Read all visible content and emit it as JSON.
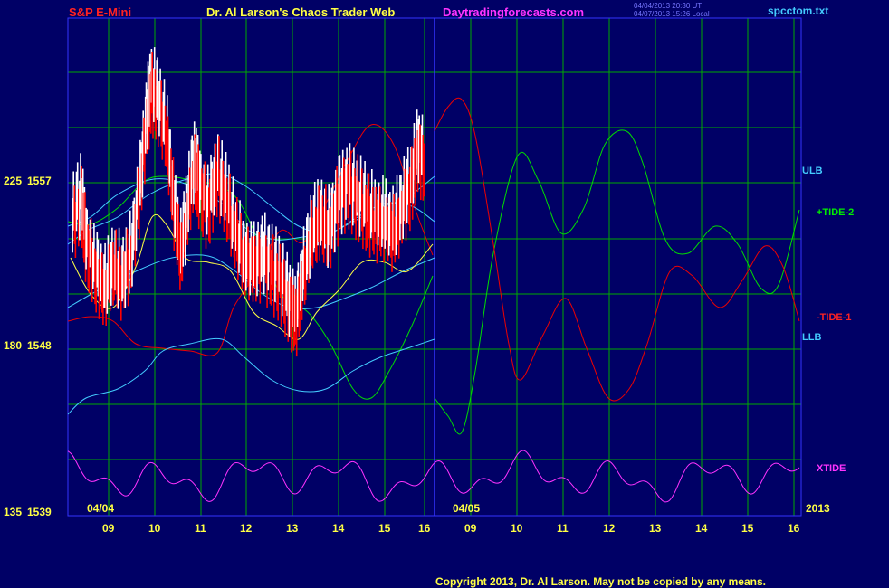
{
  "header": {
    "instrument": "S&P E-Mini",
    "site_title": "Dr. Al Larson's Chaos Trader Web",
    "site_url": "Daytradingforecasts.com",
    "timestamp_line1": "04/04/2013 20:30 UT",
    "timestamp_line2": "04/07/2013 15:26 Local",
    "file_name": "spcctom.txt"
  },
  "footer": {
    "copyright": "Copyright 2013, Dr. Al Larson. May not be copied by any means."
  },
  "colors": {
    "background": "#000066",
    "grid": "#00aa00",
    "frame": "#3333ff",
    "price_up": "#ffffff",
    "price_down": "#ff0000",
    "tide_plus": "#00dd00",
    "tide_minus": "#ee0000",
    "ulb": "#44ccff",
    "llb": "#44ccff",
    "xtide": "#ff33ff",
    "avg": "#ffff44"
  },
  "chart_data": {
    "type": "line",
    "y_labels": [
      {
        "tide": "225",
        "price": "1557"
      },
      {
        "tide": "180",
        "price": "1548"
      },
      {
        "tide": "135",
        "price": "1539"
      }
    ],
    "price_range": [
      1539,
      1560
    ],
    "x_hour_labels": [
      "09",
      "10",
      "11",
      "12",
      "13",
      "14",
      "15",
      "16",
      "09",
      "10",
      "11",
      "12",
      "13",
      "14",
      "15",
      "16"
    ],
    "date_labels": [
      "04/04",
      "04/05",
      "2013"
    ],
    "series_labels": {
      "ulb": "ULB",
      "llb": "LLB",
      "tide_plus": "+TIDE-2",
      "tide_minus": "-TIDE-1",
      "xtide": "XTIDE"
    },
    "price_bars_approx": [
      {
        "t": 8.2,
        "price": 1551.5
      },
      {
        "t": 8.4,
        "price": 1552.5
      },
      {
        "t": 8.5,
        "price": 1550.5
      },
      {
        "t": 8.7,
        "price": 1549.5
      },
      {
        "t": 8.9,
        "price": 1548.5
      },
      {
        "t": 9.1,
        "price": 1549.5
      },
      {
        "t": 9.3,
        "price": 1549.0
      },
      {
        "t": 9.5,
        "price": 1550.0
      },
      {
        "t": 9.7,
        "price": 1553.0
      },
      {
        "t": 9.85,
        "price": 1556.0
      },
      {
        "t": 9.95,
        "price": 1557.0
      },
      {
        "t": 10.1,
        "price": 1556.5
      },
      {
        "t": 10.3,
        "price": 1555.0
      },
      {
        "t": 10.45,
        "price": 1552.0
      },
      {
        "t": 10.6,
        "price": 1550.0
      },
      {
        "t": 10.75,
        "price": 1552.0
      },
      {
        "t": 10.9,
        "price": 1554.0
      },
      {
        "t": 11.0,
        "price": 1553.0
      },
      {
        "t": 11.2,
        "price": 1552.0
      },
      {
        "t": 11.4,
        "price": 1553.5
      },
      {
        "t": 11.6,
        "price": 1552.5
      },
      {
        "t": 11.8,
        "price": 1551.0
      },
      {
        "t": 12.0,
        "price": 1550.0
      },
      {
        "t": 12.2,
        "price": 1549.5
      },
      {
        "t": 12.4,
        "price": 1550.0
      },
      {
        "t": 12.6,
        "price": 1549.5
      },
      {
        "t": 12.8,
        "price": 1549.0
      },
      {
        "t": 13.0,
        "price": 1548.0
      },
      {
        "t": 13.15,
        "price": 1547.5
      },
      {
        "t": 13.3,
        "price": 1549.0
      },
      {
        "t": 13.5,
        "price": 1551.0
      },
      {
        "t": 13.7,
        "price": 1551.5
      },
      {
        "t": 13.9,
        "price": 1551.0
      },
      {
        "t": 14.1,
        "price": 1552.5
      },
      {
        "t": 14.3,
        "price": 1553.0
      },
      {
        "t": 14.5,
        "price": 1552.5
      },
      {
        "t": 14.7,
        "price": 1552.0
      },
      {
        "t": 14.9,
        "price": 1551.5
      },
      {
        "t": 15.1,
        "price": 1551.5
      },
      {
        "t": 15.3,
        "price": 1551.0
      },
      {
        "t": 15.5,
        "price": 1552.0
      },
      {
        "t": 15.7,
        "price": 1553.0
      },
      {
        "t": 15.85,
        "price": 1554.5
      },
      {
        "t": 16.0,
        "price": 1554.0
      }
    ]
  }
}
